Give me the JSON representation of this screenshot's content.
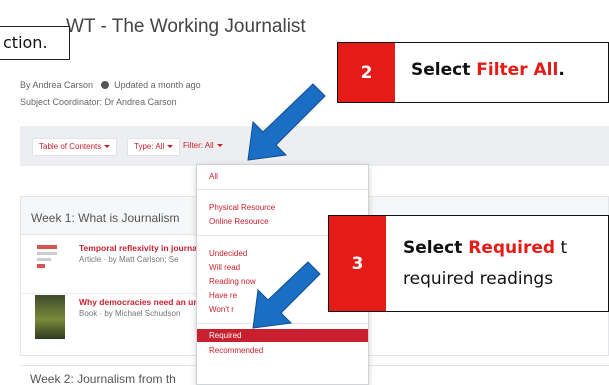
{
  "header": {
    "title": "WT - The Working Journalist",
    "callout_left": "ction."
  },
  "meta": {
    "author": "By Andrea Carson",
    "updated": "Updated a month ago",
    "coordinator": "Subject Coordinator: Dr Andrea Carson"
  },
  "filter_bar": {
    "toc_label": "Table of Contents",
    "type_label": "Type: All",
    "filter_label": "Filter: All"
  },
  "week1": {
    "title": "Week 1: What is Journalism",
    "resources": [
      {
        "title": "Temporal reflexivity in journa",
        "meta": "Article  ·  by Matt Carlson; Se"
      },
      {
        "title": "Why democracies need an un",
        "meta": "Book  ·  by Michael Schudson"
      }
    ]
  },
  "week2": {
    "title": "Week 2: Journalism from th"
  },
  "dropdown": {
    "all": "All",
    "physical": "Physical Resource",
    "online": "Online Resource",
    "undecided": "Undecided",
    "will_read": "Will read",
    "reading_now": "Reading now",
    "have_read": "Have re",
    "wont_read": "Won't r",
    "required": "Required",
    "recommended": "Recommended"
  },
  "callouts": {
    "step2": {
      "number": "2",
      "prefix": "Select ",
      "highlight": "Filter All",
      "suffix": "."
    },
    "step3": {
      "number": "3",
      "prefix": "Select ",
      "highlight": "Required",
      "suffix": " t",
      "line2": "required readings"
    }
  },
  "colors": {
    "accent_red": "#c8202f",
    "callout_red": "#e41b17",
    "arrow_blue": "#1a6fc4",
    "filter_bar_bg": "#eceef1"
  }
}
